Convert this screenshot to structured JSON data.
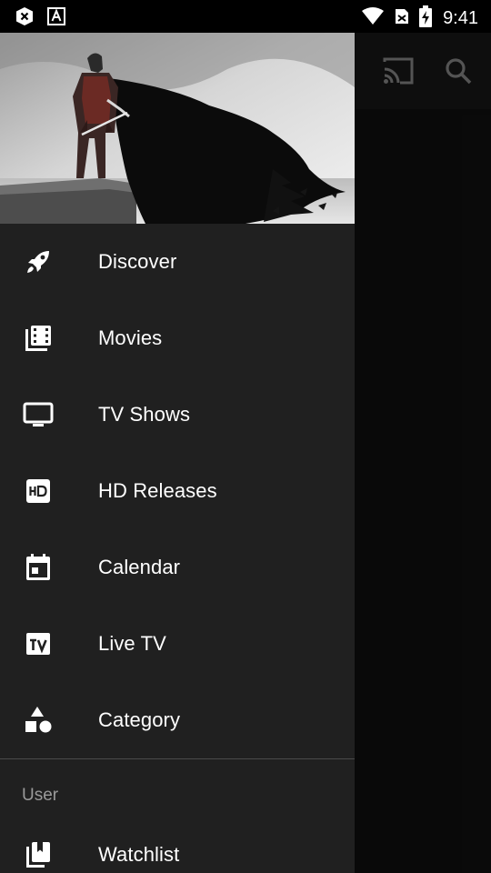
{
  "status_bar": {
    "time": "9:41",
    "icons": [
      "close-circle-icon",
      "font-icon",
      "wifi-icon",
      "no-sim-icon",
      "battery-charging-icon"
    ]
  },
  "toolbar": {
    "icons": [
      "cast-icon",
      "search-icon"
    ]
  },
  "drawer": {
    "header_image": "caped-warrior-artwork",
    "items": [
      {
        "label": "Discover",
        "icon": "rocket-icon"
      },
      {
        "label": "Movies",
        "icon": "movie-roll-icon"
      },
      {
        "label": "TV Shows",
        "icon": "tv-icon"
      },
      {
        "label": "HD Releases",
        "icon": "hd-icon"
      },
      {
        "label": "Calendar",
        "icon": "calendar-icon"
      },
      {
        "label": "Live TV",
        "icon": "live-tv-icon"
      },
      {
        "label": "Category",
        "icon": "shapes-icon"
      }
    ],
    "user_section": {
      "title": "User",
      "items": [
        {
          "label": "Watchlist",
          "icon": "bookmark-multiple-icon"
        }
      ]
    }
  },
  "colors": {
    "drawer_bg": "#202020",
    "text_primary": "#ffffff",
    "text_secondary": "#9a9a9a",
    "divider": "#4a4a4a"
  }
}
